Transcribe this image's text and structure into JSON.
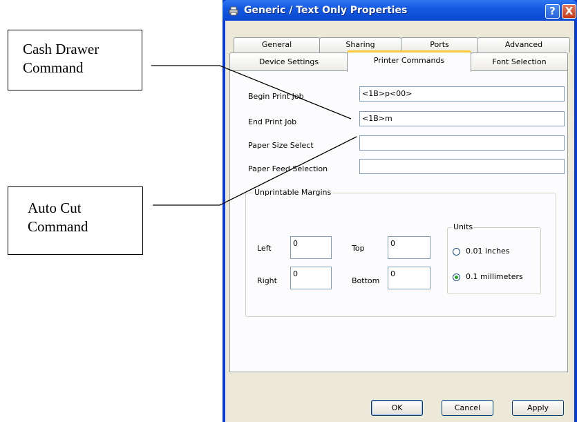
{
  "callouts": {
    "cash_drawer": [
      "Cash Drawer",
      "Command"
    ],
    "auto_cut": [
      "Auto Cut",
      "Command"
    ]
  },
  "window": {
    "title": "Generic / Text Only Properties",
    "help_glyph": "?",
    "close_glyph": "X",
    "title_color": "#0a48cf"
  },
  "tabs": {
    "row_back": [
      "General",
      "Sharing",
      "Ports",
      "Advanced"
    ],
    "row_front": [
      "Device Settings",
      "Printer Commands",
      "Font Selection"
    ],
    "active": "Printer Commands"
  },
  "commands": {
    "begin_label": "Begin Print Job",
    "begin_value": "<1B>p<00>",
    "end_label": "End Print Job",
    "end_value": "<1B>m",
    "paper_size_label": "Paper Size Select",
    "paper_size_value": "",
    "paper_feed_label": "Paper Feed Selection",
    "paper_feed_value": ""
  },
  "margins": {
    "title": "Unprintable Margins",
    "left_label": "Left",
    "left_value": "0",
    "top_label": "Top",
    "top_value": "0",
    "right_label": "Right",
    "right_value": "0",
    "bottom_label": "Bottom",
    "bottom_value": "0"
  },
  "units": {
    "title": "Units",
    "options": [
      "0.01 inches",
      "0.1 millimeters"
    ],
    "selected": "0.1 millimeters"
  },
  "buttons": {
    "ok": "OK",
    "cancel": "Cancel",
    "apply": "Apply"
  }
}
